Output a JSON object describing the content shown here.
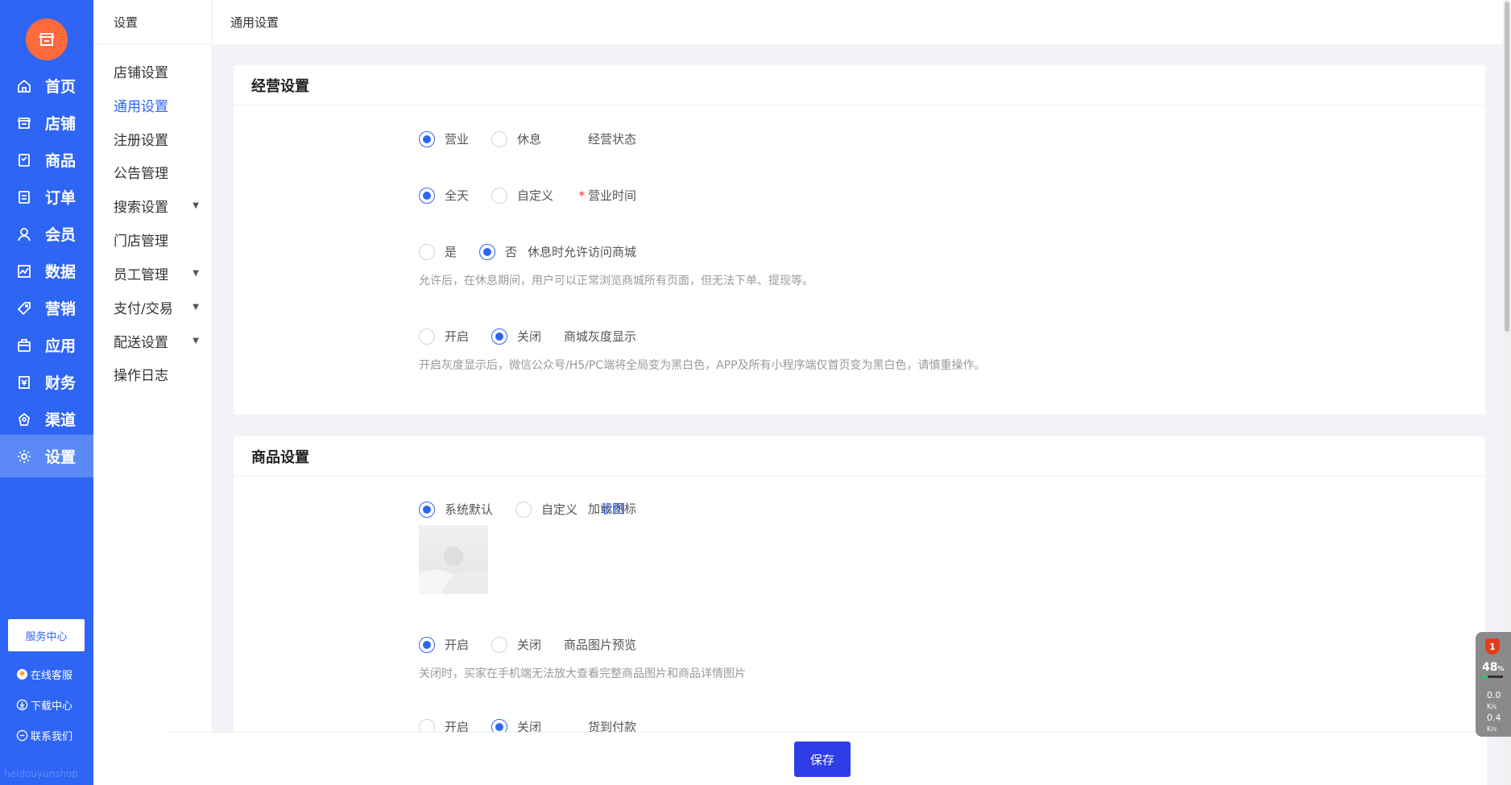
{
  "nav": {
    "items": [
      {
        "label": "首页",
        "icon": "home-icon"
      },
      {
        "label": "店铺",
        "icon": "store-icon"
      },
      {
        "label": "商品",
        "icon": "goods-icon"
      },
      {
        "label": "订单",
        "icon": "order-icon"
      },
      {
        "label": "会员",
        "icon": "member-icon"
      },
      {
        "label": "数据",
        "icon": "chart-icon"
      },
      {
        "label": "营销",
        "icon": "tag-icon"
      },
      {
        "label": "应用",
        "icon": "app-icon"
      },
      {
        "label": "财务",
        "icon": "finance-icon"
      },
      {
        "label": "渠道",
        "icon": "channel-icon"
      },
      {
        "label": "设置",
        "icon": "gear-icon"
      }
    ],
    "active": "设置",
    "service_center": "服务中心",
    "links": [
      "在线客服",
      "下载中心",
      "联系我们"
    ],
    "watermark": "heidouyunshop"
  },
  "sidebar": {
    "title": "设置",
    "items": [
      {
        "label": "店铺设置"
      },
      {
        "label": "通用设置"
      },
      {
        "label": "注册设置"
      },
      {
        "label": "公告管理"
      },
      {
        "label": "搜索设置",
        "caret": "▼"
      },
      {
        "label": "门店管理"
      },
      {
        "label": "员工管理",
        "caret": "▼"
      },
      {
        "label": "支付/交易",
        "caret": "▼"
      },
      {
        "label": "配送设置",
        "caret": "▼"
      },
      {
        "label": "操作日志"
      }
    ],
    "active": "通用设置"
  },
  "header": {
    "breadcrumb": "通用设置"
  },
  "business": {
    "title": "经营设置",
    "status": {
      "label": "经营状态",
      "options": [
        "营业",
        "休息"
      ],
      "selected": "营业"
    },
    "hours": {
      "required_mark": "*",
      "label": "营业时间",
      "options": [
        "全天",
        "自定义"
      ],
      "selected": "全天"
    },
    "rest_access": {
      "label": "休息时允许访问商城",
      "options": [
        "是",
        "否"
      ],
      "selected": "否",
      "hint": "允许后，在休息期间，用户可以正常浏览商城所有页面，但无法下单、提现等。"
    },
    "gray": {
      "label": "商城灰度显示",
      "options": [
        "开启",
        "关闭"
      ],
      "selected": "关闭",
      "hint": "开启灰度显示后，微信公众号/H5/PC端将全局变为黑白色，APP及所有小程序端仅首页变为黑白色，请慎重操作。"
    }
  },
  "goods": {
    "title": "商品设置",
    "loading_icon": {
      "label": "加载图标",
      "options": [
        "系统默认",
        "自定义"
      ],
      "selected": "系统默认",
      "example": "示例"
    },
    "preview": {
      "label": "商品图片预览",
      "options": [
        "开启",
        "关闭"
      ],
      "selected": "开启",
      "hint": "关闭时，买家在手机端无法放大查看完整商品图片和商品详情图片"
    },
    "cod": {
      "label": "货到付款",
      "options": [
        "开启",
        "关闭"
      ],
      "selected": "关闭"
    }
  },
  "footer": {
    "save": "保存"
  },
  "widget": {
    "badge": "1",
    "percent": "48",
    "percent_unit": "%",
    "up": "0.0",
    "down": "0.4",
    "unit": "K/s"
  },
  "colors": {
    "primary": "#2e65f4",
    "logo": "#ff6a3d",
    "save": "#2e3de8"
  }
}
